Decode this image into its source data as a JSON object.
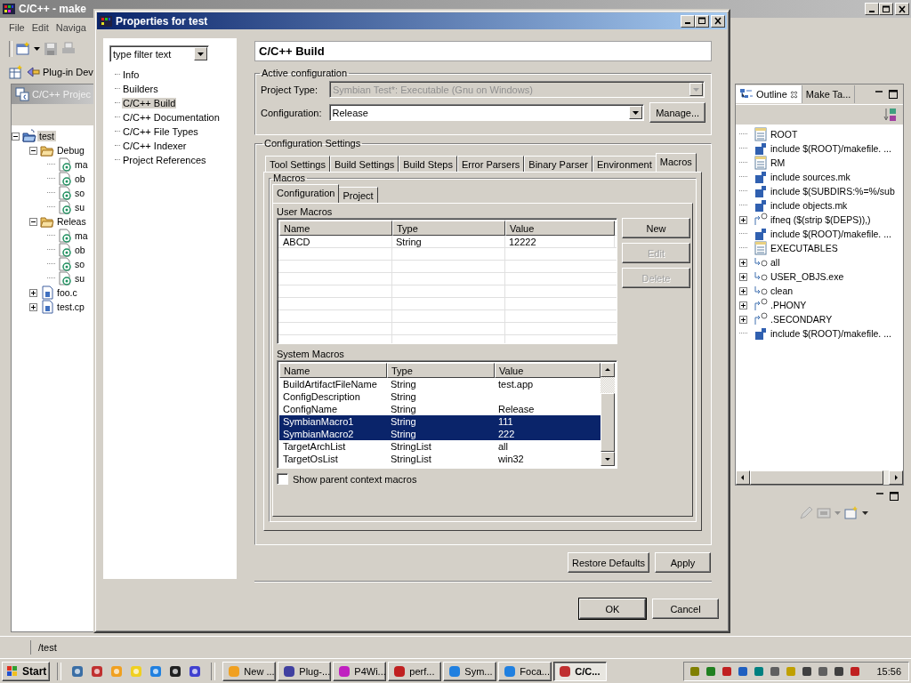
{
  "ide": {
    "title": "C/C++ - make",
    "menu": [
      "File",
      "Edit",
      "Naviga"
    ],
    "perspective": "Plug-in Dev",
    "projects_view": {
      "title": "C/C++ Projec",
      "tree": [
        {
          "label": "test",
          "kind": "project",
          "expanded": true,
          "selected": true,
          "children": [
            {
              "label": "Debug",
              "kind": "folder",
              "expanded": true,
              "selected": false,
              "children": [
                {
                  "label": "ma",
                  "kind": "file",
                  "selected": false
                },
                {
                  "label": "ob",
                  "kind": "file",
                  "selected": false
                },
                {
                  "label": "so",
                  "kind": "file",
                  "selected": false
                },
                {
                  "label": "su",
                  "kind": "file",
                  "selected": false
                }
              ]
            },
            {
              "label": "Releas",
              "kind": "folder",
              "expanded": true,
              "selected": false,
              "children": [
                {
                  "label": "ma",
                  "kind": "file",
                  "selected": false
                },
                {
                  "label": "ob",
                  "kind": "file",
                  "selected": false
                },
                {
                  "label": "so",
                  "kind": "file",
                  "selected": false
                },
                {
                  "label": "su",
                  "kind": "file",
                  "selected": false
                }
              ]
            },
            {
              "label": "foo.c",
              "kind": "source",
              "expanded": false,
              "selected": false
            },
            {
              "label": "test.cp",
              "kind": "source",
              "expanded": false,
              "selected": false
            }
          ]
        }
      ]
    },
    "outline_view": {
      "tabs": [
        {
          "label": "Outline",
          "selected": true
        },
        {
          "label": "Make Ta...",
          "selected": false
        }
      ],
      "items": [
        {
          "label": "ROOT",
          "kind": "variable"
        },
        {
          "label": "include $(ROOT)/makefile. ...",
          "kind": "include"
        },
        {
          "label": "RM",
          "kind": "variable"
        },
        {
          "label": "include sources.mk",
          "kind": "include"
        },
        {
          "label": "include $(SUBDIRS:%=%/sub",
          "kind": "include"
        },
        {
          "label": "include objects.mk",
          "kind": "include"
        },
        {
          "label": "ifneq ($(strip $(DEPS)),)",
          "kind": "conditional",
          "expanded": false
        },
        {
          "label": "include $(ROOT)/makefile. ...",
          "kind": "include"
        },
        {
          "label": "EXECUTABLES",
          "kind": "variable"
        },
        {
          "label": "all",
          "kind": "rule",
          "expanded": false
        },
        {
          "label": "USER_OBJS.exe",
          "kind": "rule",
          "expanded": false
        },
        {
          "label": "clean",
          "kind": "rule",
          "expanded": false
        },
        {
          "label": ".PHONY",
          "kind": "conditional",
          "expanded": false
        },
        {
          "label": ".SECONDARY",
          "kind": "conditional",
          "expanded": false
        },
        {
          "label": "include $(ROOT)/makefile. ...",
          "kind": "include"
        }
      ]
    },
    "status_bar": "/test"
  },
  "dialog": {
    "title": "Properties for test",
    "filter": {
      "placeholder": "type filter text"
    },
    "nav": [
      {
        "label": "Info",
        "selected": false
      },
      {
        "label": "Builders",
        "selected": false
      },
      {
        "label": "C/C++ Build",
        "selected": true
      },
      {
        "label": "C/C++ Documentation",
        "selected": false
      },
      {
        "label": "C/C++ File Types",
        "selected": false
      },
      {
        "label": "C/C++ Indexer",
        "selected": false
      },
      {
        "label": "Project References",
        "selected": false
      }
    ],
    "page_title": "C/C++ Build",
    "active_configuration": {
      "title": "Active configuration",
      "project_type_label": "Project Type:",
      "project_type": "Symbian Test*: Executable (Gnu on Windows)",
      "project_type_disabled": true,
      "configuration_label": "Configuration:",
      "configuration": "Release",
      "manage_button": "Manage..."
    },
    "configuration_settings": {
      "title": "Configuration Settings",
      "tabs": [
        {
          "label": "Tool Settings",
          "selected": false
        },
        {
          "label": "Build Settings",
          "selected": false
        },
        {
          "label": "Build Steps",
          "selected": false
        },
        {
          "label": "Error Parsers",
          "selected": false
        },
        {
          "label": "Binary Parser",
          "selected": false
        },
        {
          "label": "Environment",
          "selected": false
        },
        {
          "label": "Macros",
          "selected": true
        }
      ],
      "macros": {
        "title": "Macros",
        "tabs": [
          {
            "label": "Configuration",
            "selected": true
          },
          {
            "label": "Project",
            "selected": false
          }
        ],
        "user_macros": {
          "title": "User Macros",
          "columns": [
            "Name",
            "Type",
            "Value"
          ],
          "rows": [
            {
              "name": "ABCD",
              "type": "String",
              "value": "12222"
            }
          ]
        },
        "buttons": [
          {
            "label": "New",
            "disabled": false
          },
          {
            "label": "Edit",
            "disabled": true
          },
          {
            "label": "Delete",
            "disabled": true
          }
        ],
        "system_macros": {
          "title": "System Macros",
          "columns": [
            "Name",
            "Type",
            "Value"
          ],
          "rows": [
            {
              "name": "BuildArtifactFileName",
              "type": "String",
              "value": "test.app",
              "selected": false
            },
            {
              "name": "ConfigDescription",
              "type": "String",
              "selected": false
            },
            {
              "name": "ConfigName",
              "type": "String",
              "value": "Release",
              "selected": false
            },
            {
              "name": "SymbianMacro1",
              "type": "String",
              "value": "111",
              "selected": true
            },
            {
              "name": "SymbianMacro2",
              "type": "String",
              "value": "222",
              "selected": true
            },
            {
              "name": "TargetArchList",
              "type": "StringList",
              "value": "all",
              "selected": false
            },
            {
              "name": "TargetOsList",
              "type": "StringList",
              "value": "win32",
              "selected": false
            }
          ]
        },
        "show_parent": {
          "label": "Show parent context macros",
          "checked": false
        }
      }
    },
    "buttons": [
      {
        "label": "Restore Defaults"
      },
      {
        "label": "Apply"
      }
    ],
    "footer_buttons": [
      {
        "label": "OK",
        "default": true
      },
      {
        "label": "Cancel",
        "default": false
      }
    ]
  },
  "taskbar": {
    "start": "Start",
    "tasks": [
      {
        "label": "New ...",
        "selected": false
      },
      {
        "label": "Plug-...",
        "selected": false
      },
      {
        "label": "P4Wi...",
        "selected": false
      },
      {
        "label": "perf...",
        "selected": false
      },
      {
        "label": "Sym...",
        "selected": false
      },
      {
        "label": "Foca...",
        "selected": false
      },
      {
        "label": "C/C...",
        "selected": true
      }
    ],
    "clock": "15:56"
  }
}
